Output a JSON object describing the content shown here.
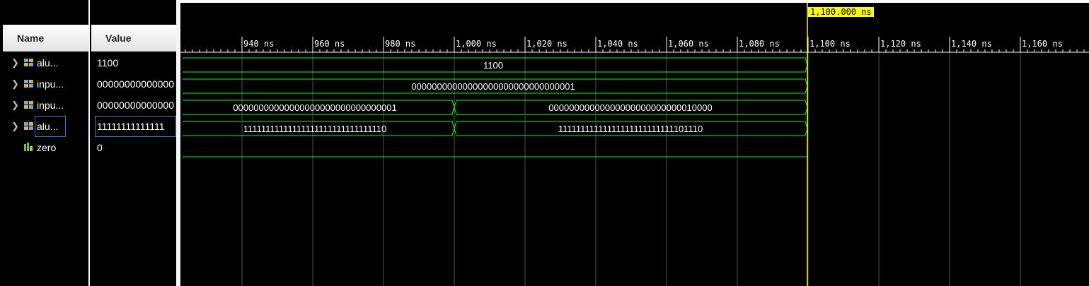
{
  "headers": {
    "name": "Name",
    "value": "Value"
  },
  "signals": [
    {
      "name": "alu...",
      "value": "1100",
      "kind": "bus",
      "expandable": true
    },
    {
      "name": "inpu...",
      "value": "00000000000000",
      "kind": "bus",
      "expandable": true
    },
    {
      "name": "inpu...",
      "value": "00000000000000",
      "kind": "bus",
      "expandable": true
    },
    {
      "name": "alu...",
      "value": "11111111111111",
      "kind": "bus",
      "expandable": true,
      "selected": true
    },
    {
      "name": "zero",
      "value": "0",
      "kind": "bit",
      "expandable": false
    }
  ],
  "timeline": {
    "ticks": [
      "940 ns",
      "960 ns",
      "980 ns",
      "1,000 ns",
      "1,020 ns",
      "1,040 ns",
      "1,060 ns",
      "1,080 ns",
      "1,100 ns",
      "1,120 ns",
      "1,140 ns",
      "1,160 ns"
    ],
    "cursor_label": "1,100.000 ns"
  },
  "waves": {
    "row0": [
      "1100"
    ],
    "row1": [
      "00000000000000000000000000000001"
    ],
    "row2": [
      "00000000000000000000000000000001",
      "00000000000000000000000000010000"
    ],
    "row3": [
      "11111111111111111111111111111110",
      "11111111111111111111111111101110"
    ]
  },
  "colors": {
    "wave": "#00ff00",
    "cursor": "#ffff00",
    "grid": "#555555",
    "background": "#000000"
  }
}
